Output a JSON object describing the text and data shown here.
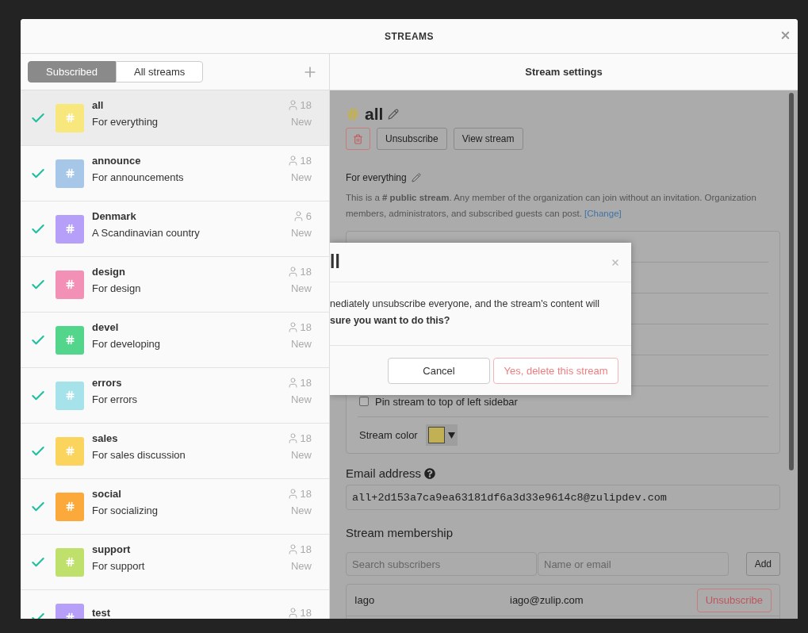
{
  "modal": {
    "title": "STREAMS"
  },
  "tabs": [
    {
      "label": "Subscribed",
      "selected": true
    },
    {
      "label": "All streams",
      "selected": false
    }
  ],
  "streams": [
    {
      "name": "all",
      "description": "For everything",
      "subscribers": "18",
      "status": "New",
      "color": "#f7e77d",
      "subscribed": true,
      "selected": true
    },
    {
      "name": "announce",
      "description": "For announcements",
      "subscribers": "18",
      "status": "New",
      "color": "#a6c7e8",
      "subscribed": true,
      "selected": false
    },
    {
      "name": "Denmark",
      "description": "A Scandinavian country",
      "subscribers": "6",
      "status": "New",
      "color": "#b59ff8",
      "subscribed": true,
      "selected": false
    },
    {
      "name": "design",
      "description": "For design",
      "subscribers": "18",
      "status": "New",
      "color": "#f291b5",
      "subscribed": true,
      "selected": false
    },
    {
      "name": "devel",
      "description": "For developing",
      "subscribers": "18",
      "status": "New",
      "color": "#53d68c",
      "subscribed": true,
      "selected": false
    },
    {
      "name": "errors",
      "description": "For errors",
      "subscribers": "18",
      "status": "New",
      "color": "#a5e2ea",
      "subscribed": true,
      "selected": false
    },
    {
      "name": "sales",
      "description": "For sales discussion",
      "subscribers": "18",
      "status": "New",
      "color": "#fbd45e",
      "subscribed": true,
      "selected": false
    },
    {
      "name": "social",
      "description": "For socializing",
      "subscribers": "18",
      "status": "New",
      "color": "#fba93a",
      "subscribed": true,
      "selected": false
    },
    {
      "name": "support",
      "description": "For support",
      "subscribers": "18",
      "status": "New",
      "color": "#bfe06a",
      "subscribed": true,
      "selected": false
    },
    {
      "name": "test",
      "subscribers": "18",
      "color": "#b59ff8",
      "subscribed": true,
      "selected": false
    }
  ],
  "settings": {
    "header": "Stream settings",
    "stream_name": "all",
    "color": "#c2b154",
    "buttons": [
      "Unsubscribe",
      "View stream"
    ],
    "description": "For everything",
    "privacy_note": "This is a **# public stream**. Any member of the organization can join without an invitation. Organization members, administrators, and subscribed guests can post.",
    "change_link": "[Change]",
    "pin_label": "Pin stream to top of left sidebar",
    "pin_checked": false,
    "color_label": "Stream color",
    "email_label": "Email address",
    "email": "all+2d153a7ca9ea63181df6a3d33e9614c8@zulipdev.com",
    "membership_title": "Stream membership",
    "search_placeholder": "Search subscribers",
    "add_placeholder": "Name or email",
    "add_button": "Add",
    "subscribers": [
      {
        "name": "Iago",
        "email": "iago@zulip.com",
        "action": "Unsubscribe"
      }
    ]
  },
  "dialog": {
    "title": "ll",
    "lines": [
      "nediately unsubscribe everyone, and the stream's content will",
      "**sure you want to do this?**"
    ],
    "cancel": "Cancel",
    "confirm": "Yes, delete this stream"
  }
}
